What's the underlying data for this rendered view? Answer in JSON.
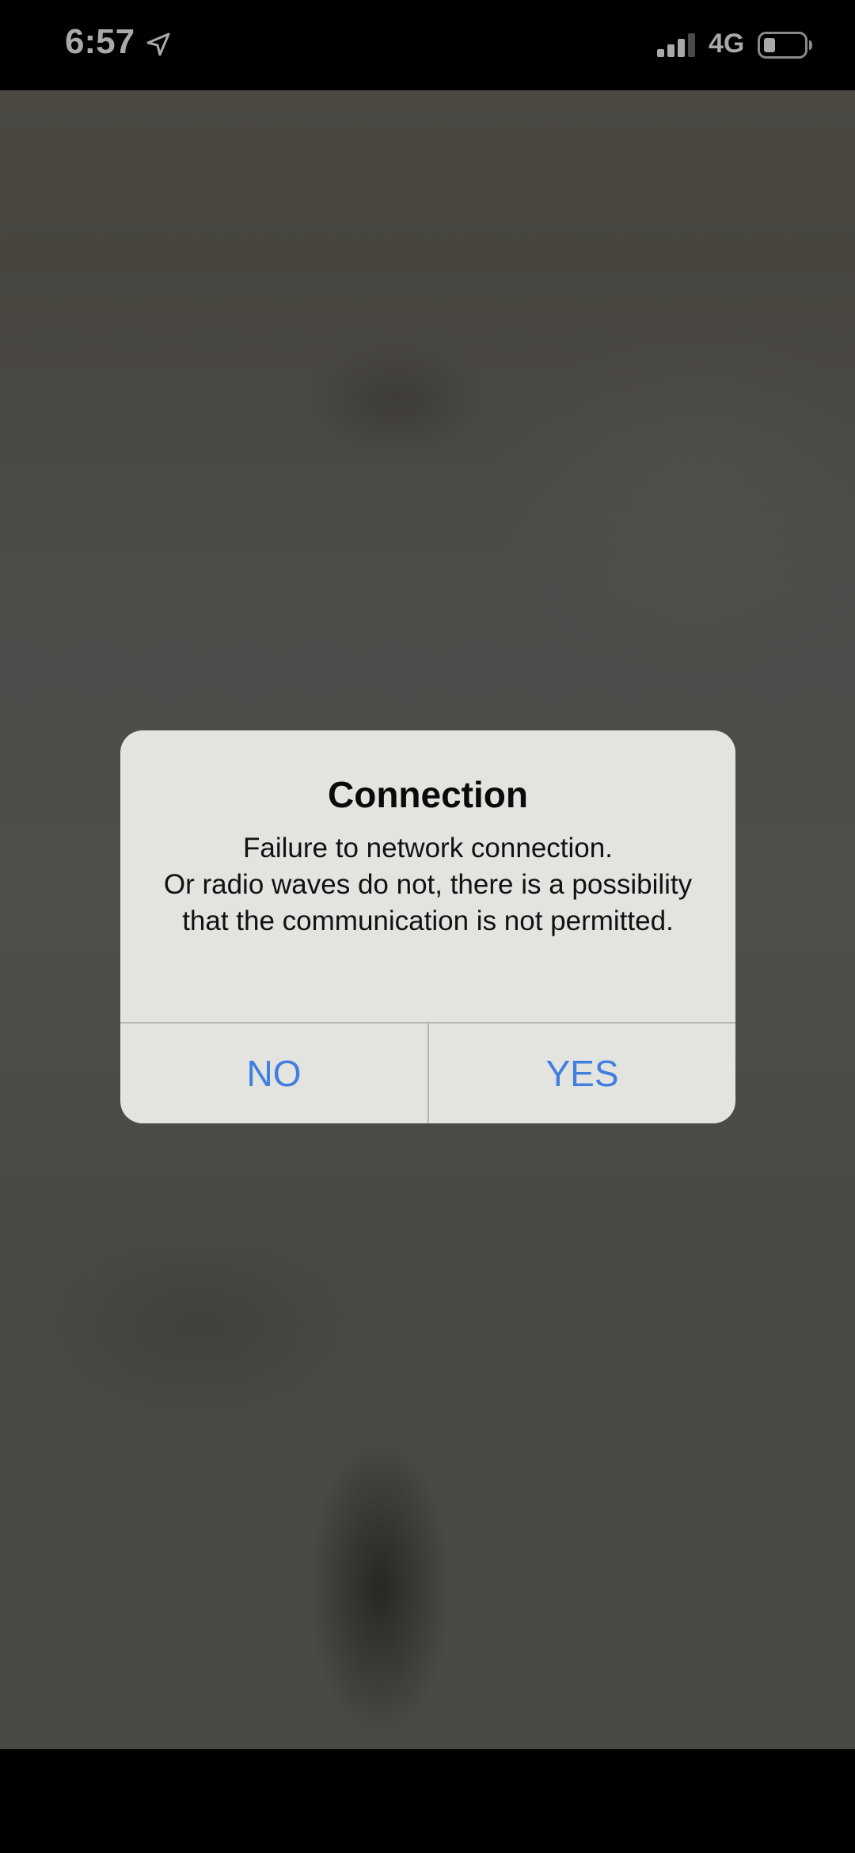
{
  "status_bar": {
    "time": "6:57",
    "network": "4G",
    "icons": [
      "location-arrow-icon",
      "cellular-signal-icon",
      "battery-icon"
    ]
  },
  "alert": {
    "title": "Connection",
    "message": "Failure to network connection.\nOr radio waves do not, there is a possibility that the communication is not permitted.",
    "no_label": "NO",
    "yes_label": "YES"
  },
  "colors": {
    "accent": "#3f7fe0",
    "alert_bg": "#e3e3e0",
    "status_text": "#a9a9a9"
  }
}
